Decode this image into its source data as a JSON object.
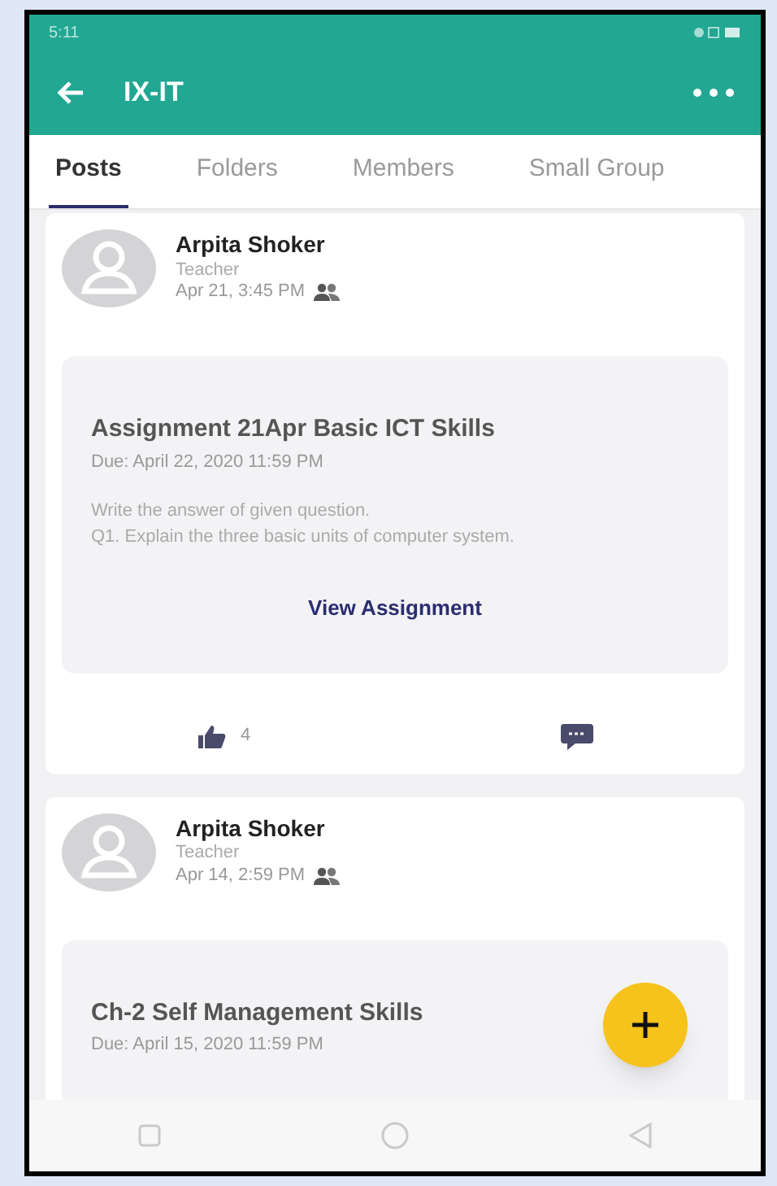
{
  "status_bar": {
    "time": "5:11"
  },
  "app_bar": {
    "title": "IX-IT"
  },
  "tabs": [
    {
      "label": "Posts",
      "selected": true
    },
    {
      "label": "Folders",
      "selected": false
    },
    {
      "label": "Members",
      "selected": false
    },
    {
      "label": "Small Group",
      "selected": false
    }
  ],
  "posts": [
    {
      "author": "Arpita Shoker",
      "role": "Teacher",
      "time": "Apr 21, 3:45 PM",
      "assignment": {
        "title": "Assignment 21Apr Basic ICT Skills",
        "due": "Due: April 22, 2020 11:59 PM",
        "description": "Write the answer of given question.\nQ1. Explain the three basic units of computer system.",
        "action": "View Assignment"
      },
      "likes": "4"
    },
    {
      "author": "Arpita Shoker",
      "role": "Teacher",
      "time": "Apr 14, 2:59 PM",
      "assignment": {
        "title": "Ch-2 Self Management Skills",
        "due": "Due: April 15, 2020 11:59 PM"
      }
    }
  ]
}
